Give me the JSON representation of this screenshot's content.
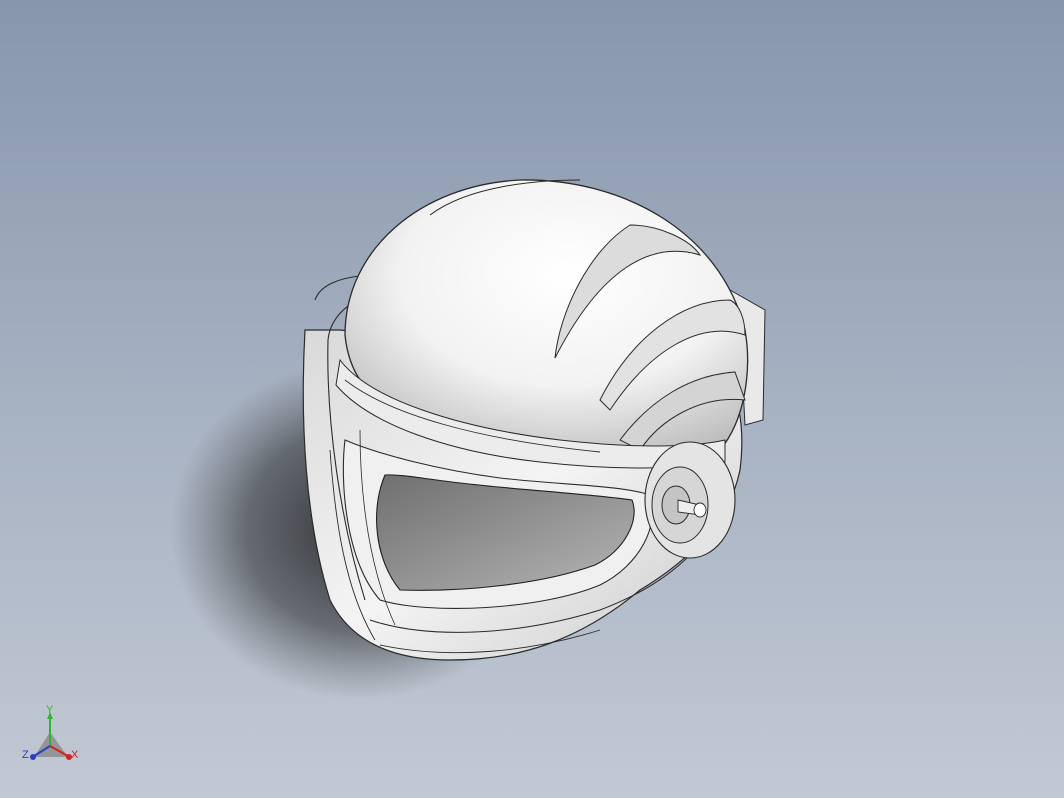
{
  "viewport": {
    "background_top": "#8896ab",
    "background_bottom": "#c2c9d4"
  },
  "model": {
    "name": "helmet-model",
    "shell_color": "#ffffff",
    "edge_color": "#2a2a2a",
    "visor_color": "#8a8a8a"
  },
  "triad": {
    "x_label": "X",
    "y_label": "Y",
    "z_label": "Z",
    "x_color": "#d42020",
    "y_color": "#2fb52f",
    "z_color": "#2a3fc8"
  }
}
